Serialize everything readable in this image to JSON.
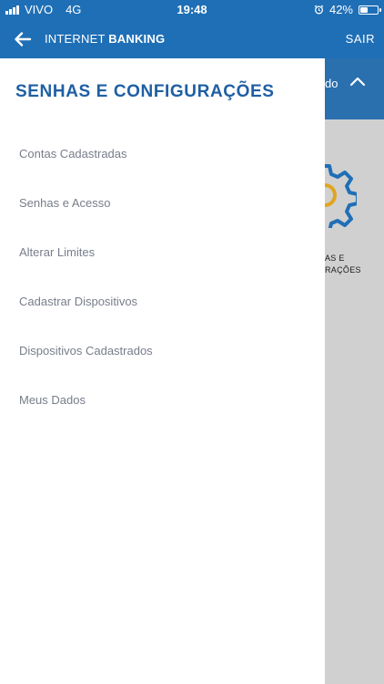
{
  "status_bar": {
    "carrier": "VIVO",
    "network": "4G",
    "time": "19:48",
    "battery": "42%",
    "battery_level": 0.42
  },
  "header": {
    "title_regular": "INTERNET ",
    "title_bold": "BANKING",
    "exit_label": "SAIR"
  },
  "background": {
    "bar_text": "do",
    "caption_line1": "AS E",
    "caption_line2": "RAÇÕES",
    "bar_color": "#2a6fae",
    "gear_color": "#1f6fb6",
    "gear_accent": "#e0a521"
  },
  "drawer": {
    "title": "SENHAS E CONFIGURAÇÕES",
    "items": [
      {
        "label": "Contas Cadastradas"
      },
      {
        "label": "Senhas e Acesso"
      },
      {
        "label": "Alterar Limites"
      },
      {
        "label": "Cadastrar Dispositivos"
      },
      {
        "label": "Dispositivos Cadastrados"
      },
      {
        "label": "Meus Dados"
      }
    ]
  },
  "colors": {
    "brand": "#1f6fb6",
    "title": "#1f5fa3",
    "menu_text": "#777d8a"
  },
  "icons": {
    "back": "arrow-left-icon",
    "chevron": "chevron-up-icon",
    "gear": "gear-icon",
    "alarm": "alarm-icon",
    "signal": "signal-icon",
    "battery": "battery-icon"
  }
}
